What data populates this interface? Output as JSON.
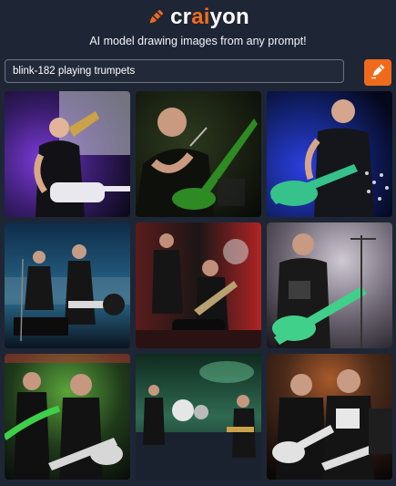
{
  "header": {
    "logo_prefix": "cr",
    "logo_accent": "ai",
    "logo_suffix": "yon",
    "tagline": "AI model drawing images from any prompt!"
  },
  "search": {
    "value": "blink-182 playing trumpets",
    "button_icon": "pencil-icon"
  },
  "colors": {
    "background": "#1e2636",
    "accent": "#f06a1c"
  },
  "results": [
    {
      "name": "generated-image-1",
      "scene": "guitarist with trumpet, purple stage light"
    },
    {
      "name": "generated-image-2",
      "scene": "singer at microphone, green guitar"
    },
    {
      "name": "generated-image-3",
      "scene": "singer with green bass, blue light"
    },
    {
      "name": "generated-image-4",
      "scene": "band on stage, blue haze"
    },
    {
      "name": "generated-image-5",
      "scene": "band on red-lit stage"
    },
    {
      "name": "generated-image-6",
      "scene": "bassist with green bass"
    },
    {
      "name": "generated-image-7",
      "scene": "two players, green light"
    },
    {
      "name": "generated-image-8",
      "scene": "wide stage view, drum kit"
    },
    {
      "name": "generated-image-9",
      "scene": "two players with guitars"
    }
  ]
}
